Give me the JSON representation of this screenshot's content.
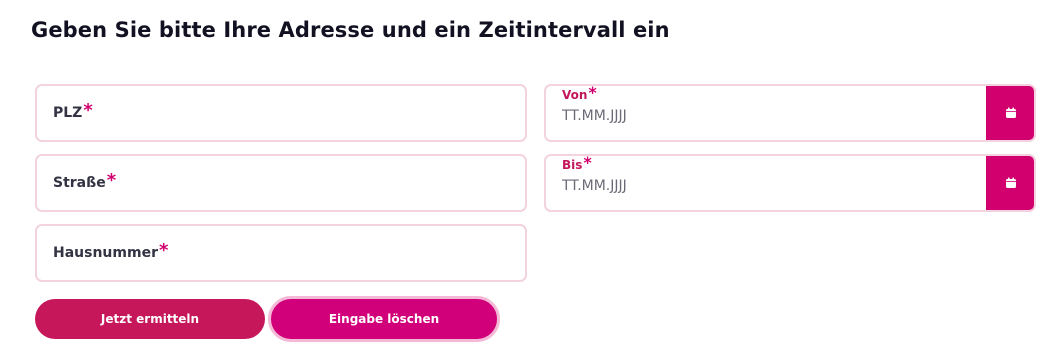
{
  "heading": "Geben Sie bitte Ihre Adresse und ein Zeitintervall ein",
  "fields": {
    "plz": {
      "label": "PLZ",
      "required_mark": "*"
    },
    "strasse": {
      "label": "Straße",
      "required_mark": "*"
    },
    "hausnummer": {
      "label": "Hausnummer",
      "required_mark": "*"
    }
  },
  "dates": {
    "von": {
      "label": "Von",
      "required_mark": "*",
      "placeholder": "TT.MM.JJJJ",
      "icon": "calendar-icon"
    },
    "bis": {
      "label": "Bis",
      "required_mark": "*",
      "placeholder": "TT.MM.JJJJ",
      "icon": "calendar-icon"
    }
  },
  "buttons": {
    "submit": "Jetzt ermitteln",
    "clear": "Eingabe löschen"
  },
  "colors": {
    "accent": "#d1006e",
    "field_border": "#f2d3df",
    "submit_bg": "#c7175b",
    "clear_bg": "#d1007a"
  }
}
